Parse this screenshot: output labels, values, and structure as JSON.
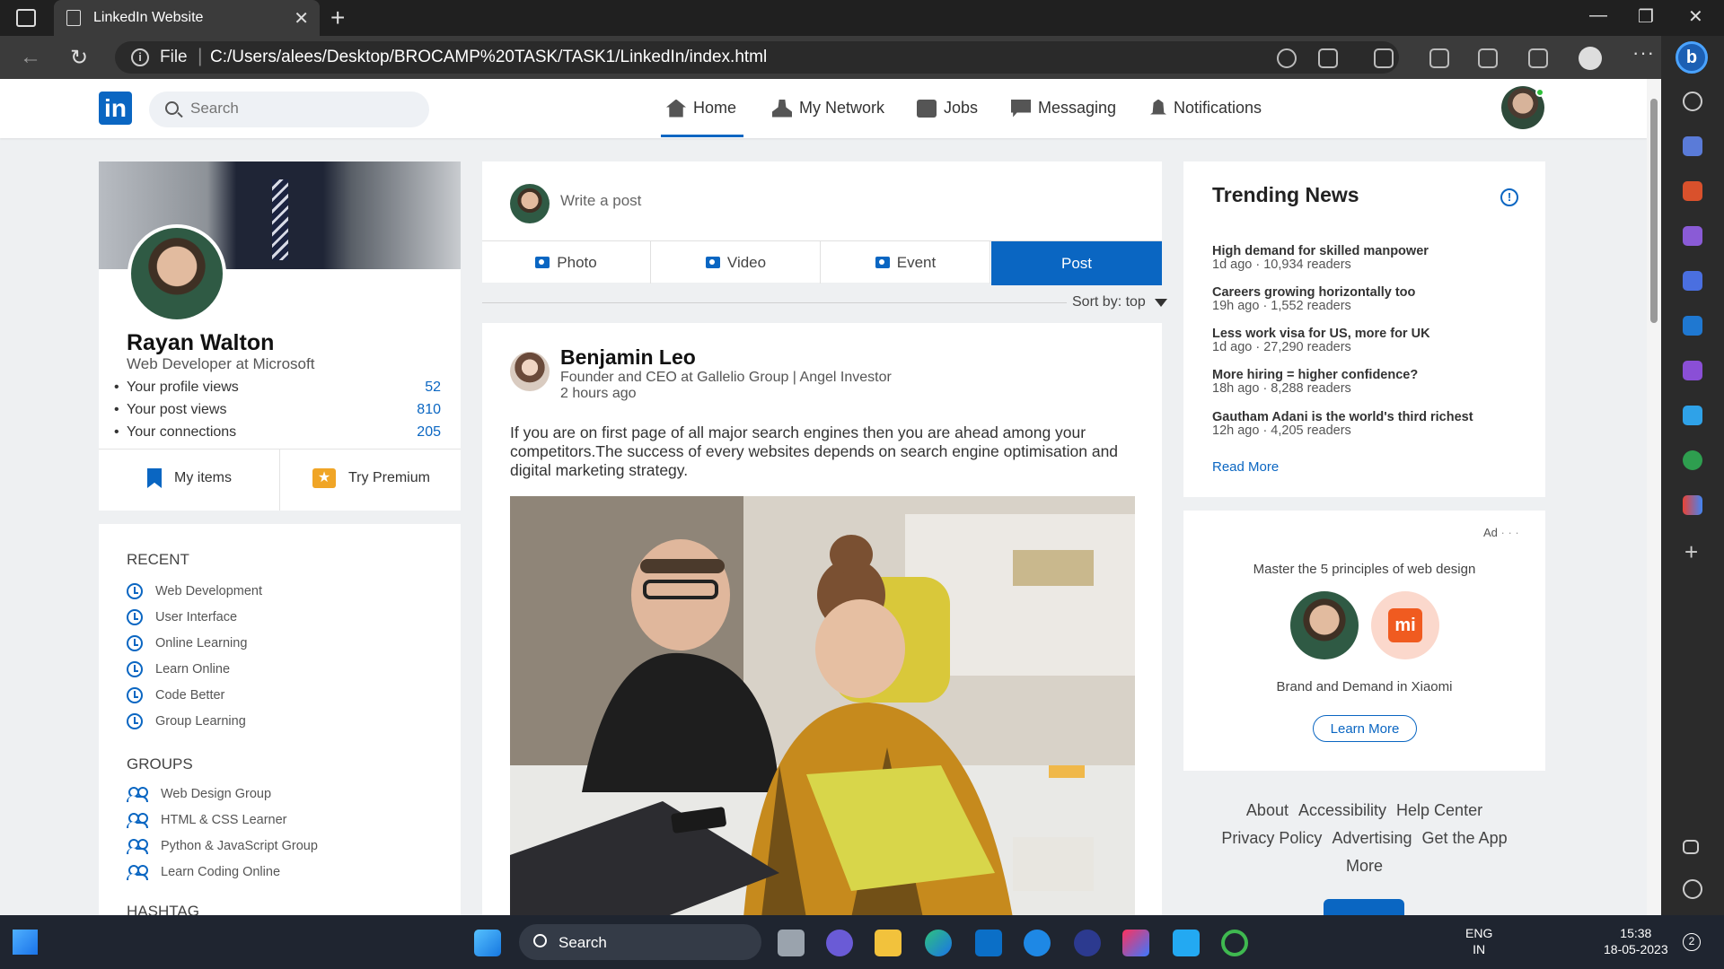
{
  "browser": {
    "tab_title": "LinkedIn Website",
    "address_scheme": "File",
    "address_path": "C:/Users/alees/Desktop/BROCAMP%20TASK/TASK1/LinkedIn/index.html"
  },
  "header": {
    "logo_text": "in",
    "search_placeholder": "Search",
    "nav": [
      {
        "label": "Home",
        "icon": "home-icon"
      },
      {
        "label": "My Network",
        "icon": "network-icon"
      },
      {
        "label": "Jobs",
        "icon": "briefcase-icon"
      },
      {
        "label": "Messaging",
        "icon": "messaging-icon"
      },
      {
        "label": "Notifications",
        "icon": "bell-icon"
      }
    ],
    "active_nav": "Home"
  },
  "profile": {
    "name": "Rayan Walton",
    "title": "Web Developer at Microsoft",
    "stats": [
      {
        "label": "Your profile views",
        "value": "52"
      },
      {
        "label": "Your post views",
        "value": "810"
      },
      {
        "label": "Your connections",
        "value": "205"
      }
    ],
    "my_items": "My items",
    "try_premium": "Try Premium"
  },
  "sidebar": {
    "recent_heading": "RECENT",
    "recent": [
      "Web Development",
      "User Interface",
      "Online Learning",
      "Learn Online",
      "Code Better",
      "Group Learning"
    ],
    "groups_heading": "GROUPS",
    "groups": [
      "Web Design Group",
      "HTML & CSS Learner",
      "Python & JavaScript Group",
      "Learn Coding Online"
    ],
    "hashtag_heading": "HASHTAG"
  },
  "composer": {
    "placeholder": "Write a post",
    "actions": [
      "Photo",
      "Video",
      "Event"
    ],
    "post_button": "Post",
    "sort_label": "Sort by: top"
  },
  "post": {
    "author": "Benjamin Leo",
    "author_title": "Founder and CEO at Gallelio Group | Angel Investor",
    "time": "2 hours ago",
    "text": "If you are on first page of all major search engines then you are ahead among your competitors.The success of every websites depends on search engine optimisation and digital marketing strategy."
  },
  "trending": {
    "title": "Trending News",
    "items": [
      {
        "headline": "High demand for skilled manpower",
        "meta": "1d ago · 10,934 readers"
      },
      {
        "headline": "Careers growing horizontally too",
        "meta": "19h ago · 1,552 readers"
      },
      {
        "headline": "Less work visa for US, more for UK",
        "meta": "1d ago · 27,290 readers"
      },
      {
        "headline": "More hiring = higher confidence?",
        "meta": "18h ago · 8,288 readers"
      },
      {
        "headline": "Gautham Adani is the world's third richest",
        "meta": "12h ago · 4,205 readers"
      }
    ],
    "read_more": "Read More"
  },
  "ad": {
    "label": "Ad",
    "dots": "· · ·",
    "headline": "Master the 5 principles of web design",
    "brand_logo": "mi",
    "sub": "Brand and Demand in Xiaomi",
    "cta": "Learn More"
  },
  "footer": {
    "links": [
      "About",
      "Accessibility",
      "Help Center",
      "Privacy Policy",
      "Advertising",
      "Get the App",
      "More"
    ]
  },
  "taskbar": {
    "search": "Search",
    "lang1": "ENG",
    "lang2": "IN",
    "time": "15:38",
    "date": "18-05-2023",
    "notifications": "2"
  },
  "colors": {
    "brand": "#0a66c2",
    "page_bg": "#eef0f2",
    "premium": "#f0a526",
    "xiaomi": "#f05b20"
  }
}
